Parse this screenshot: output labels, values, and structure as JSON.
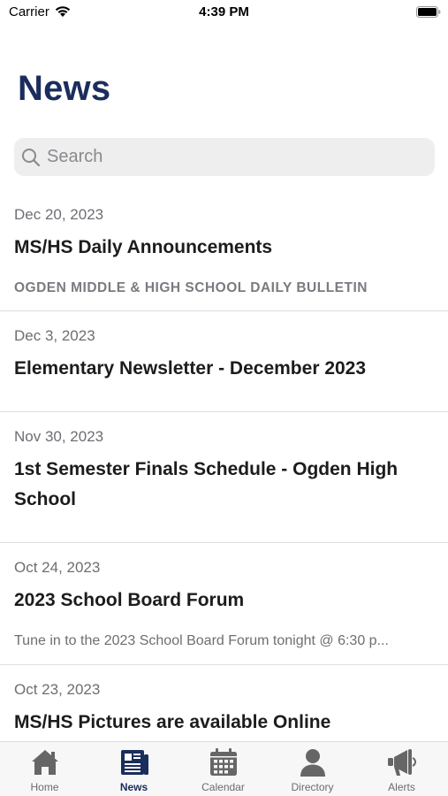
{
  "status_bar": {
    "carrier": "Carrier",
    "time": "4:39 PM"
  },
  "page": {
    "title": "News"
  },
  "search": {
    "placeholder": "Search"
  },
  "news": [
    {
      "date": "Dec 20, 2023",
      "title": "MS/HS Daily Announcements",
      "summary": "OGDEN MIDDLE & HIGH SCHOOL DAILY BULLETIN"
    },
    {
      "date": "Dec 3, 2023",
      "title": "Elementary Newsletter - December 2023",
      "summary": ""
    },
    {
      "date": "Nov 30, 2023",
      "title": "1st Semester Finals Schedule - Ogden High School",
      "summary": ""
    },
    {
      "date": "Oct 24, 2023",
      "title": "2023 School Board Forum",
      "summary": "Tune in to the 2023 School Board Forum tonight @ 6:30 p..."
    },
    {
      "date": "Oct 23, 2023",
      "title": "MS/HS Pictures are available Online",
      "summary": ""
    }
  ],
  "tabs": [
    {
      "label": "Home",
      "icon": "home-icon",
      "active": false
    },
    {
      "label": "News",
      "icon": "newspaper-icon",
      "active": true
    },
    {
      "label": "Calendar",
      "icon": "calendar-icon",
      "active": false
    },
    {
      "label": "Directory",
      "icon": "person-icon",
      "active": false
    },
    {
      "label": "Alerts",
      "icon": "megaphone-icon",
      "active": false
    }
  ],
  "colors": {
    "brand_navy": "#1b2d5c",
    "inactive_tab": "#6b6b6b",
    "tab_icon_gray": "#666666"
  }
}
